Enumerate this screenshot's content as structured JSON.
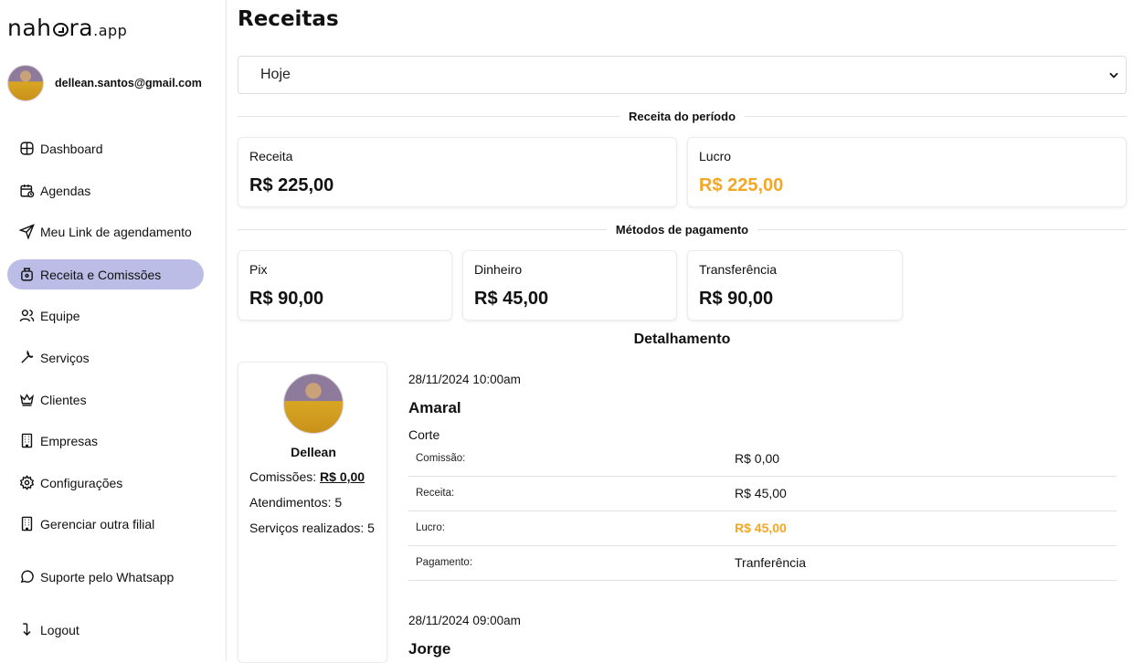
{
  "brand": {
    "name_left": "nah",
    "name_right": "ra",
    "suffix": ".app"
  },
  "user": {
    "email": "dellean.santos@gmail.com"
  },
  "nav": [
    {
      "label": "Dashboard",
      "icon": "dashboard-icon"
    },
    {
      "label": "Agendas",
      "icon": "calendar-icon"
    },
    {
      "label": "Meu Link de agendamento",
      "icon": "send-icon"
    },
    {
      "label": "Receita e Comissões",
      "icon": "money-bag-icon",
      "active": true
    },
    {
      "label": "Equipe",
      "icon": "users-icon"
    },
    {
      "label": "Serviços",
      "icon": "wrench-icon"
    },
    {
      "label": "Clientes",
      "icon": "crown-icon"
    },
    {
      "label": "Empresas",
      "icon": "building-icon"
    },
    {
      "label": "Configurações",
      "icon": "gear-icon"
    },
    {
      "label": "Gerenciar outra filial",
      "icon": "building-icon"
    },
    {
      "label": "Suporte pelo Whatsapp",
      "icon": "chat-icon"
    },
    {
      "label": "Logout",
      "icon": "logout-icon"
    }
  ],
  "page": {
    "title": "Receitas"
  },
  "period": {
    "selected": "Hoje"
  },
  "revenue_section": {
    "title": "Receita do período",
    "cards": [
      {
        "label": "Receita",
        "value": "R$ 225,00"
      },
      {
        "label": "Lucro",
        "value": "R$ 225,00"
      }
    ]
  },
  "payment_section": {
    "title": "Métodos de pagamento",
    "cards": [
      {
        "label": "Pix",
        "value": "R$ 90,00"
      },
      {
        "label": "Dinheiro",
        "value": "R$ 45,00"
      },
      {
        "label": "Transferência",
        "value": "R$ 90,00"
      }
    ]
  },
  "detail": {
    "title": "Detalhamento",
    "member": {
      "name": "Dellean",
      "commissions_label": "Comissões:",
      "commissions_value": "R$ 0,00",
      "appointments": "Atendimentos: 5",
      "services": "Serviços realizados: 5"
    },
    "appointments": [
      {
        "datetime": "28/11/2024 10:00am",
        "client": "Amaral",
        "service": "Corte",
        "rows": [
          {
            "key": "Comissão:",
            "value": "R$ 0,00"
          },
          {
            "key": "Receita:",
            "value": "R$ 45,00"
          },
          {
            "key": "Lucro:",
            "value": "R$ 45,00"
          },
          {
            "key": "Pagamento:",
            "value": "Tranferência"
          }
        ]
      },
      {
        "datetime": "28/11/2024 09:00am",
        "client": "Jorge"
      }
    ]
  },
  "colors": {
    "accent_nav": "#bcbde6",
    "profit": "#f5a623"
  }
}
